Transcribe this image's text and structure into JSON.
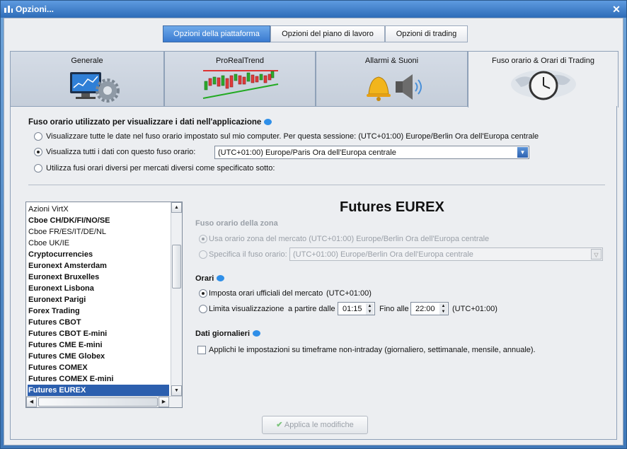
{
  "window": {
    "title": "Opzioni...",
    "close_glyph": "✕"
  },
  "top_tabs": [
    "Opzioni della piattaforma",
    "Opzioni del piano di lavoro",
    "Opzioni di trading"
  ],
  "main_tabs": [
    "Generale",
    "ProRealTrend",
    "Allarmi & Suoni",
    "Fuso orario & Orari di Trading"
  ],
  "timezone_section": {
    "heading": "Fuso orario utilizzato per visualizzare i dati nell'applicazione",
    "option1": "Visualizzare tutte le date nel fuso orario impostato sul mio computer. Per questa sessione: (UTC+01:00) Europe/Berlin Ora dell'Europa centrale",
    "option2": "Visualizza tutti i dati con questo fuso orario:",
    "option2_value": "(UTC+01:00) Europe/Paris Ora dell'Europa centrale",
    "option3": "Utilizza fusi orari diversi per mercati diversi come specificato sotto:"
  },
  "markets": [
    {
      "label": "Azioni VirtX",
      "bold": false
    },
    {
      "label": "Cboe CH/DK/FI/NO/SE",
      "bold": true
    },
    {
      "label": "Cboe FR/ES/IT/DE/NL",
      "bold": false
    },
    {
      "label": "Cboe UK/IE",
      "bold": false
    },
    {
      "label": "Cryptocurrencies",
      "bold": true
    },
    {
      "label": "Euronext Amsterdam",
      "bold": true
    },
    {
      "label": "Euronext Bruxelles",
      "bold": true
    },
    {
      "label": "Euronext Lisbona",
      "bold": true
    },
    {
      "label": "Euronext Parigi",
      "bold": true
    },
    {
      "label": "Forex Trading",
      "bold": true
    },
    {
      "label": "Futures CBOT",
      "bold": true
    },
    {
      "label": "Futures CBOT E-mini",
      "bold": true
    },
    {
      "label": "Futures CME E-mini",
      "bold": true
    },
    {
      "label": "Futures CME Globex",
      "bold": true
    },
    {
      "label": "Futures COMEX",
      "bold": true
    },
    {
      "label": "Futures COMEX E-mini",
      "bold": true
    },
    {
      "label": "Futures EUREX",
      "bold": true,
      "selected": true
    }
  ],
  "detail": {
    "title": "Futures EUREX",
    "zone_heading": "Fuso orario della zona",
    "zone_option1": "Usa orario zona del mercato (UTC+01:00) Europe/Berlin Ora dell'Europa centrale",
    "zone_option2": "Specifica il fuso orario:",
    "zone_option2_value": "(UTC+01:00) Europe/Berlin Ora dell'Europa centrale",
    "hours_heading": "Orari",
    "hours_option1": "Imposta orari ufficiali del mercato",
    "hours_option1_tz": "(UTC+01:00)",
    "hours_option2": "Limita visualizzazione",
    "from_label": "a partire dalle",
    "from_value": "01:15",
    "to_label": "Fino alle",
    "to_value": "22:00",
    "hours_option2_tz": "(UTC+01:00)",
    "daily_heading": "Dati giornalieri",
    "daily_checkbox": "Applichi le impostazioni su timeframe non-intraday (giornaliero, settimanale, mensile, annuale)."
  },
  "apply_button": "Applica le modifiche",
  "colors": {
    "accent": "#3a7bd0",
    "selection": "#2c5fae",
    "info_bubble": "#2f8fe8"
  }
}
